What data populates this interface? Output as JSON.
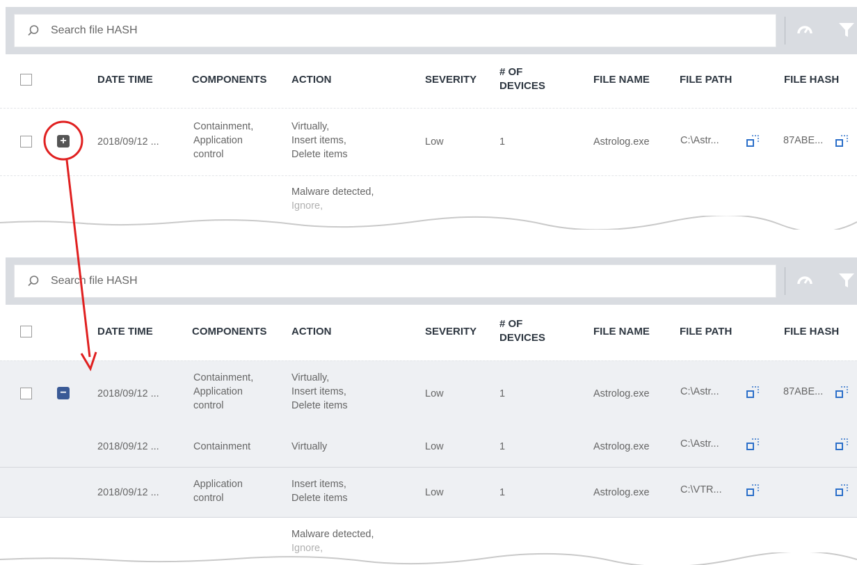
{
  "search": {
    "placeholder": "Search file HASH"
  },
  "headers": {
    "date_time": "DATE TIME",
    "components": "COMPONENTS",
    "action": "ACTION",
    "severity": "SEVERITY",
    "devices_line1": "# OF",
    "devices_line2": "DEVICES",
    "file_name": "FILE NAME",
    "file_path": "FILE PATH",
    "file_hash": "FILE HASH"
  },
  "top_panel": {
    "row1": {
      "date_time": "2018/09/12 ...",
      "components": [
        "Containment,",
        "Application",
        "control"
      ],
      "action": [
        "Virtually,",
        "Insert items,",
        "Delete items"
      ],
      "severity": "Low",
      "devices": "1",
      "file_name": "Astrolog.exe",
      "file_path": "C:\\Astr...",
      "file_hash": "87ABE...",
      "expand_symbol": "+"
    },
    "row2": {
      "action": [
        "Malware detected,",
        "Ignore,"
      ]
    }
  },
  "bottom_panel": {
    "row1": {
      "date_time": "2018/09/12 ...",
      "components": [
        "Containment,",
        "Application",
        "control"
      ],
      "action": [
        "Virtually,",
        "Insert items,",
        "Delete items"
      ],
      "severity": "Low",
      "devices": "1",
      "file_name": "Astrolog.exe",
      "file_path": "C:\\Astr...",
      "file_hash": "87ABE...",
      "expand_symbol": "−"
    },
    "sub1": {
      "date_time": "2018/09/12 ...",
      "components": "Containment",
      "action": "Virtually",
      "severity": "Low",
      "devices": "1",
      "file_name": "Astrolog.exe",
      "file_path": "C:\\Astr..."
    },
    "sub2": {
      "date_time": "2018/09/12 ...",
      "components": [
        "Application",
        "control"
      ],
      "action": [
        "Insert items,",
        "Delete items"
      ],
      "severity": "Low",
      "devices": "1",
      "file_name": "Astrolog.exe",
      "file_path": "C:\\VTR..."
    },
    "row2": {
      "action": [
        "Malware detected,",
        "Ignore,"
      ]
    }
  },
  "colors": {
    "annotation": "#e02020",
    "minus_button": "#3a5a96",
    "copy_icon": "#2b6fc9"
  },
  "icons": [
    "search-icon",
    "dashboard-icon",
    "filter-icon",
    "expand-icon",
    "collapse-icon",
    "copy-icon"
  ]
}
